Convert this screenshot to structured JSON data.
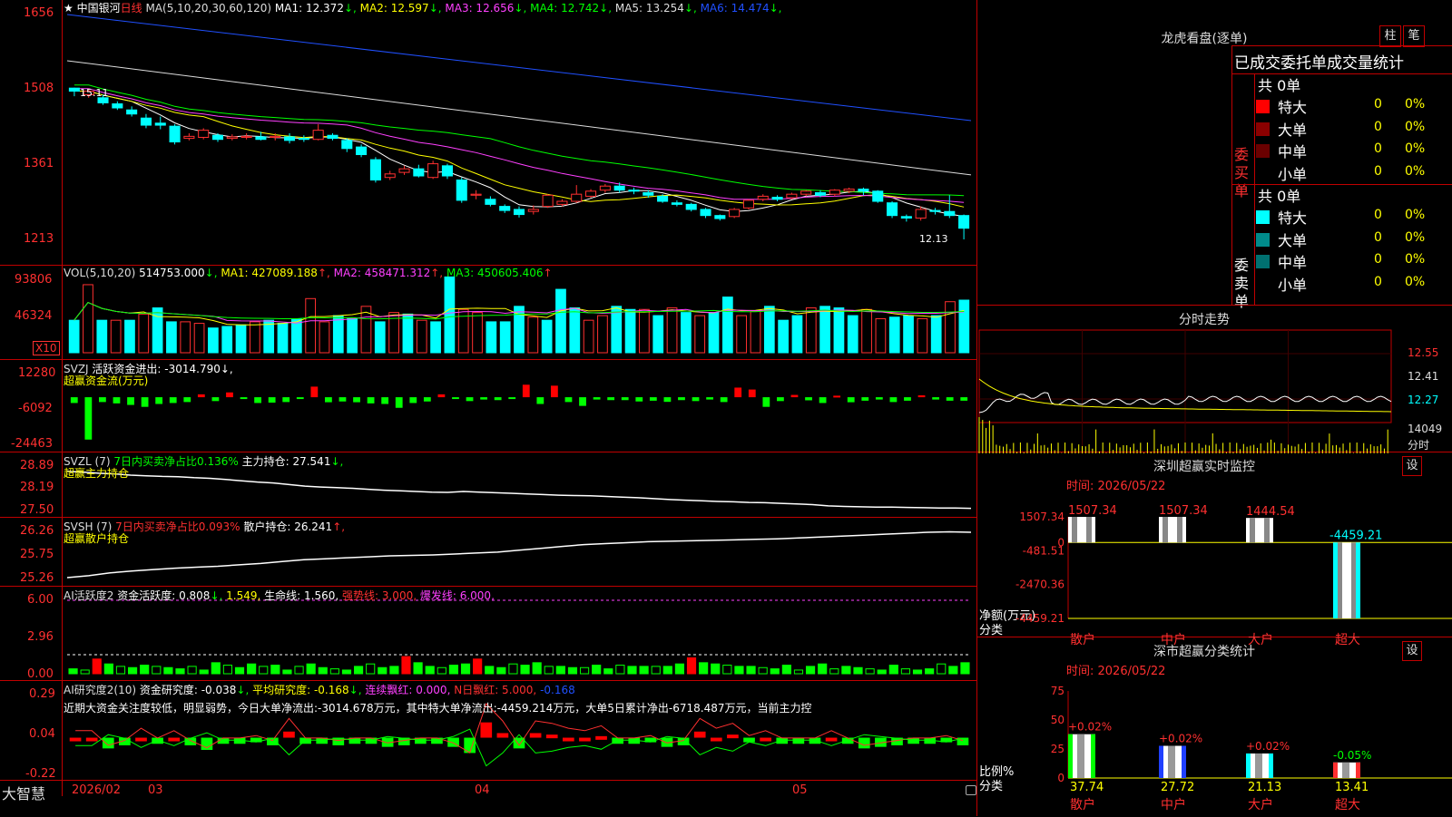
{
  "header": {
    "star": "★",
    "stock_name": "中国银河",
    "period": "日线",
    "ma_title": "MA(5,10,20,30,60,120)",
    "ma": [
      {
        "label": "MA1: 12.372",
        "arrow": "↓",
        "color": "#ffffff"
      },
      {
        "label": "MA2: 12.597",
        "arrow": "↓",
        "color": "#ffff00"
      },
      {
        "label": "MA3: 12.656",
        "arrow": "↓",
        "color": "#ff40ff"
      },
      {
        "label": "MA4: 12.742",
        "arrow": "↓",
        "color": "#00ff00"
      },
      {
        "label": "MA5: 13.254",
        "arrow": "↓",
        "color": "#dddddd"
      },
      {
        "label": "MA6: 14.474",
        "arrow": "↓",
        "color": "#2050ff"
      }
    ]
  },
  "price_panel": {
    "yticks": [
      "1656",
      "1508",
      "1361",
      "1213"
    ],
    "high_label": "15.11",
    "low_label": "12.13"
  },
  "vol_panel": {
    "title": "VOL(5,10,20)",
    "value": "514753.000",
    "ma1": "MA1: 427089.188",
    "ma2": "MA2: 458471.312",
    "ma3": "MA3: 450605.406",
    "yticks": [
      "93806",
      "46324"
    ],
    "unit": "X10"
  },
  "svzj_panel": {
    "title": "SVZJ",
    "text1": "活跃资金进出: -3014.790",
    "text2": "超赢资金流(万元)",
    "yticks": [
      "12280",
      "-6092",
      "-24463"
    ]
  },
  "svzl_panel": {
    "title": "SVZL (7)",
    "text1": "7日内买卖净占比0.136%",
    "text2": "主力持仓: 27.541",
    "text3": "超赢主力持仓",
    "yticks": [
      "28.89",
      "28.19",
      "27.50"
    ]
  },
  "svsh_panel": {
    "title": "SVSH (7)",
    "text1": "7日内买卖净占比0.093%",
    "text2": "散户持仓: 26.241",
    "text3": "超赢散户持仓",
    "yticks": [
      "26.26",
      "25.75",
      "25.26"
    ]
  },
  "ai_active_panel": {
    "title": "AI活跃度2",
    "text1": "资金活跃度: 0.808",
    "text2": "1.549,",
    "text3": "生命线: 1.560,",
    "text4": "强势线: 3.000,",
    "text5": "爆发线: 6.000,",
    "yticks": [
      "6.00",
      "2.96",
      "0.00"
    ]
  },
  "ai_research_panel": {
    "title": "AI研究度2(10)",
    "text1": "资金研究度: -0.038",
    "text2": "平均研究度: -0.168",
    "text3": "连续飘红: 0.000,",
    "text4": "N日飘红: 5.000,",
    "text5": "-0.168",
    "comment": "近期大资金关注度较低，明显弱势，今日大单净流出:-3014.678万元，其中特大单净流出:-4459.214万元，大单5日累计净出-6718.487万元，当前主力控",
    "yticks": [
      "0.29",
      "0.04",
      "-0.22"
    ]
  },
  "xaxis": {
    "labels": [
      "2026/02",
      "03",
      "04",
      "05"
    ],
    "brand": "大智慧"
  },
  "right_panel": {
    "longhu_title": "龙虎看盘(逐单)",
    "tab1": "柱",
    "tab2": "笔",
    "stats_title": "已成交委托单成交量统计",
    "buy_label": "委买单",
    "sell_label": "委卖单",
    "buy_total": "共 0单",
    "sell_total": "共 0单",
    "buy_rows": [
      {
        "name": "特大",
        "count": "0",
        "pct": "0%",
        "color": "#ff0000"
      },
      {
        "name": "大单",
        "count": "0",
        "pct": "0%",
        "color": "#8b0000"
      },
      {
        "name": "中单",
        "count": "0",
        "pct": "0%",
        "color": "#6a0000"
      },
      {
        "name": "小单",
        "count": "0",
        "pct": "0%",
        "color": "#000000"
      }
    ],
    "sell_rows": [
      {
        "name": "特大",
        "count": "0",
        "pct": "0%",
        "color": "#00ffff"
      },
      {
        "name": "大单",
        "count": "0",
        "pct": "0%",
        "color": "#008b8b"
      },
      {
        "name": "中单",
        "count": "0",
        "pct": "0%",
        "color": "#007070"
      },
      {
        "name": "小单",
        "count": "0",
        "pct": "0%",
        "color": "#000000"
      }
    ],
    "fenshi_title": "分时走势",
    "fenshi_prices": [
      "12.55",
      "12.41",
      "12.27"
    ],
    "fenshi_vol": "14049",
    "fenshi_unit": "分时",
    "sz_monitor_title": "深圳超赢实时监控",
    "sz_monitor_btn": "设",
    "sz_monitor_time": "时间: 2026/05/22",
    "sz_monitor_yticks": [
      "1507.34",
      "0",
      "-481.51",
      "-2470.36",
      "-4459.21"
    ],
    "sz_monitor_ylabel": "净额(万元)",
    "sz_monitor_xlabel": "分类",
    "sz_class_title": "深市超赢分类统计",
    "sz_class_btn": "设",
    "sz_class_time": "时间: 2026/05/22",
    "sz_class_yticks": [
      "75",
      "50",
      "25",
      "0"
    ],
    "sz_class_ylabel": "比例%",
    "sz_class_xlabel": "分类"
  },
  "chart_data": [
    {
      "type": "candlestick",
      "title": "中国银河 日线",
      "xlabels": [
        "2026/02",
        "03",
        "04",
        "05"
      ],
      "ylim": [
        1213,
        1656
      ],
      "candles": [
        [
          15.11,
          15.05,
          15.12,
          14.95
        ],
        [
          14.98,
          15.05,
          15.1,
          14.92
        ],
        [
          14.92,
          14.82,
          14.98,
          14.78
        ],
        [
          14.8,
          14.72,
          14.85,
          14.68
        ],
        [
          14.68,
          14.6,
          14.75,
          14.55
        ],
        [
          14.52,
          14.38,
          14.6,
          14.32
        ],
        [
          14.42,
          14.38,
          14.55,
          14.3
        ],
        [
          14.36,
          14.05,
          14.4,
          14.0
        ],
        [
          14.12,
          14.16,
          14.22,
          14.08
        ],
        [
          14.14,
          14.28,
          14.32,
          14.1
        ],
        [
          14.18,
          14.1,
          14.22,
          14.05
        ],
        [
          14.12,
          14.15,
          14.2,
          14.08
        ],
        [
          14.14,
          14.16,
          14.22,
          14.1
        ],
        [
          14.15,
          14.1,
          14.25,
          14.08
        ],
        [
          14.14,
          14.16,
          14.22,
          14.08
        ],
        [
          14.15,
          14.08,
          14.22,
          14.02
        ],
        [
          14.12,
          14.1,
          14.18,
          14.05
        ],
        [
          14.1,
          14.28,
          14.4,
          14.08
        ],
        [
          14.18,
          14.12,
          14.22,
          14.08
        ],
        [
          14.08,
          13.92,
          14.12,
          13.85
        ],
        [
          13.95,
          13.8,
          14.0,
          13.75
        ],
        [
          13.7,
          13.3,
          13.75,
          13.25
        ],
        [
          13.35,
          13.42,
          13.48,
          13.3
        ],
        [
          13.45,
          13.52,
          13.58,
          13.4
        ],
        [
          13.52,
          13.38,
          13.6,
          13.35
        ],
        [
          13.35,
          13.62,
          13.68,
          13.32
        ],
        [
          13.58,
          13.38,
          13.62,
          13.32
        ],
        [
          13.3,
          12.9,
          13.35,
          12.85
        ],
        [
          13.0,
          13.02,
          13.1,
          12.92
        ],
        [
          12.92,
          12.82,
          12.98,
          12.78
        ],
        [
          12.78,
          12.7,
          12.82,
          12.65
        ],
        [
          12.72,
          12.62,
          12.78,
          12.56
        ],
        [
          12.68,
          12.72,
          12.8,
          12.62
        ],
        [
          12.78,
          13.0,
          13.02,
          12.75
        ],
        [
          12.82,
          12.88,
          12.92,
          12.78
        ],
        [
          12.88,
          13.02,
          13.2,
          12.85
        ],
        [
          12.98,
          13.08,
          13.12,
          12.95
        ],
        [
          13.1,
          13.18,
          13.22,
          13.05
        ],
        [
          13.18,
          13.1,
          13.25,
          13.05
        ],
        [
          13.1,
          13.08,
          13.15,
          13.02
        ],
        [
          13.05,
          13.0,
          13.1,
          12.95
        ],
        [
          12.98,
          12.88,
          13.02,
          12.85
        ],
        [
          12.85,
          12.82,
          12.9,
          12.78
        ],
        [
          12.82,
          12.72,
          12.85,
          12.68
        ],
        [
          12.72,
          12.6,
          12.75,
          12.55
        ],
        [
          12.6,
          12.54,
          12.62,
          12.5
        ],
        [
          12.58,
          12.72,
          12.75,
          12.55
        ],
        [
          12.75,
          12.9,
          12.92,
          12.72
        ],
        [
          12.92,
          12.98,
          13.02,
          12.88
        ],
        [
          12.96,
          12.92,
          13.0,
          12.88
        ],
        [
          12.95,
          13.02,
          13.05,
          12.92
        ],
        [
          13.02,
          13.08,
          13.1,
          12.98
        ],
        [
          13.05,
          13.0,
          13.1,
          12.96
        ],
        [
          13.02,
          13.1,
          13.12,
          12.98
        ],
        [
          13.08,
          13.12,
          13.15,
          13.04
        ],
        [
          13.12,
          13.08,
          13.15,
          13.0
        ],
        [
          13.08,
          12.88,
          13.1,
          12.85
        ],
        [
          12.85,
          12.6,
          12.88,
          12.55
        ],
        [
          12.58,
          12.55,
          12.62,
          12.48
        ],
        [
          12.55,
          12.72,
          12.78,
          12.5
        ],
        [
          12.7,
          12.68,
          12.75,
          12.62
        ],
        [
          12.68,
          12.6,
          13.0,
          12.55
        ],
        [
          12.6,
          12.35,
          12.62,
          12.13
        ]
      ]
    },
    {
      "type": "bar",
      "title": "VOL(5,10,20)",
      "ylim": [
        0,
        93806
      ],
      "values": [
        42000,
        88000,
        42000,
        42000,
        42000,
        50000,
        58000,
        40000,
        40000,
        38000,
        32000,
        34000,
        36000,
        40000,
        42000,
        38000,
        44000,
        70000,
        40000,
        48000,
        44000,
        60000,
        40000,
        52000,
        50000,
        42000,
        40000,
        98000,
        56000,
        52000,
        40000,
        40000,
        60000,
        46000,
        42000,
        82000,
        58000,
        42000,
        48000,
        60000,
        56000,
        56000,
        48000,
        58000,
        52000,
        48000,
        52000,
        72000,
        48000,
        54000,
        60000,
        42000,
        48000,
        58000,
        60000,
        58000,
        48000,
        56000,
        44000,
        46000,
        48000,
        44000,
        48000,
        66000,
        68000
      ]
    },
    {
      "type": "bar",
      "title": "SVZJ 超赢资金流(万元)",
      "ylim": [
        -24463,
        12280
      ],
      "values": [
        -3000,
        -22000,
        -2500,
        -3200,
        -4000,
        -5000,
        -3500,
        -3000,
        -2500,
        1500,
        -2000,
        2500,
        -800,
        -3000,
        -2800,
        -2500,
        -500,
        5500,
        -2600,
        -2200,
        -2600,
        -3200,
        -3500,
        -5500,
        -3000,
        -2200,
        1500,
        -500,
        -2000,
        -1200,
        -1500,
        -600,
        6500,
        -3500,
        6000,
        -2500,
        -4500,
        -1200,
        -1500,
        -1500,
        -2200,
        -1800,
        -2400,
        -1500,
        -2000,
        -1200,
        -2500,
        5000,
        4000,
        -5000,
        -2000,
        1200,
        -1600,
        -3000,
        800,
        -2600,
        -1800,
        -1200,
        -2500,
        -1800,
        1000,
        -1200,
        -1800,
        -1800
      ]
    },
    {
      "type": "line",
      "title": "SVZL 超赢主力持仓",
      "ylim": [
        27.5,
        28.89
      ],
      "values": [
        28.72,
        28.7,
        28.66,
        28.64,
        28.6,
        28.58,
        28.56,
        28.55,
        28.52,
        28.5,
        28.46,
        28.42,
        28.38,
        28.35,
        28.3,
        28.25,
        28.22,
        28.2,
        28.18,
        28.15,
        28.12,
        28.1,
        28.08,
        28.06,
        28.05,
        28.08,
        28.06,
        28.04,
        28.02,
        28.0,
        27.98,
        27.96,
        27.95,
        27.94,
        27.92,
        27.9,
        27.88,
        27.85,
        27.82,
        27.8,
        27.78,
        27.76,
        27.75,
        27.73,
        27.72,
        27.7,
        27.68,
        27.66,
        27.62,
        27.6,
        27.59,
        27.58,
        27.58,
        27.57,
        27.56,
        27.55,
        27.55,
        27.54
      ]
    },
    {
      "type": "line",
      "title": "SVSH 超赢散户持仓",
      "ylim": [
        25.26,
        26.26
      ],
      "values": [
        25.28,
        25.32,
        25.38,
        25.42,
        25.45,
        25.48,
        25.5,
        25.52,
        25.55,
        25.58,
        25.62,
        25.66,
        25.68,
        25.7,
        25.72,
        25.74,
        25.75,
        25.76,
        25.78,
        25.8,
        25.82,
        25.86,
        25.9,
        25.94,
        25.98,
        26.0,
        26.02,
        26.04,
        26.05,
        26.06,
        26.07,
        26.08,
        26.09,
        26.1,
        26.12,
        26.14,
        26.16,
        26.18,
        26.2,
        26.22,
        26.24,
        26.25,
        26.24
      ]
    },
    {
      "type": "bar",
      "title": "AI活跃度2",
      "ylim": [
        0,
        6.0
      ],
      "values": [
        0.4,
        0.3,
        1.2,
        0.8,
        0.6,
        0.5,
        0.7,
        0.6,
        0.5,
        0.4,
        0.6,
        0.3,
        0.9,
        0.7,
        0.5,
        0.8,
        0.6,
        0.7,
        0.3,
        0.6,
        0.8,
        0.5,
        0.4,
        0.3,
        0.6,
        0.8,
        0.5,
        0.6,
        1.4,
        0.9,
        0.6,
        0.5,
        0.7,
        0.8,
        1.2,
        0.6,
        0.5,
        0.8,
        0.7,
        0.9,
        0.6,
        0.6,
        0.5,
        0.5,
        0.7,
        0.4,
        0.7,
        0.6,
        0.6,
        0.6,
        0.6,
        0.8,
        1.3,
        0.9,
        0.8,
        0.7,
        0.6,
        0.6,
        0.5,
        0.4,
        0.7,
        0.3,
        0.6,
        0.8,
        0.4,
        0.6,
        0.5,
        0.4,
        0.3,
        0.7,
        0.4,
        0.3,
        0.4,
        0.8,
        0.6,
        0.9
      ]
    },
    {
      "type": "bar",
      "title": "AI研究度2(10)",
      "ylim": [
        -0.22,
        0.29
      ],
      "values": [
        0.01,
        0.01,
        -0.05,
        -0.03,
        0.02,
        -0.02,
        0.01,
        -0.03,
        -0.06,
        -0.02,
        -0.02,
        -0.01,
        -0.03,
        0.06,
        -0.02,
        -0.02,
        -0.03,
        -0.02,
        -0.02,
        -0.04,
        -0.03,
        -0.02,
        -0.02,
        -0.04,
        -0.08,
        0.12,
        0.05,
        -0.05,
        0.05,
        0.04,
        0.02,
        0.01,
        0.03,
        -0.02,
        -0.02,
        -0.01,
        -0.04,
        -0.03,
        0.06,
        0.02,
        0.04,
        -0.01,
        0.01,
        -0.02,
        -0.02,
        -0.02,
        0.01,
        -0.02,
        -0.05,
        -0.04,
        -0.03,
        -0.02,
        -0.02,
        -0.01,
        -0.03
      ]
    },
    {
      "type": "bar",
      "title": "深圳超赢实时监控",
      "ylim": [
        -4459.21,
        1507.34
      ],
      "categories": [
        "散户",
        "中户",
        "大户",
        "超大"
      ],
      "values": [
        1507.34,
        1507.34,
        1444.54,
        -4459.21
      ],
      "value_labels": [
        "1507.34",
        "1507.34",
        "1444.54",
        "-4459.21"
      ]
    },
    {
      "type": "bar",
      "title": "深市超赢分类统计",
      "ylim": [
        0,
        75
      ],
      "categories": [
        "散户",
        "中户",
        "大户",
        "超大"
      ],
      "values": [
        37.74,
        27.72,
        21.13,
        13.41
      ],
      "changes": [
        "+0.02%",
        "+0.02%",
        "+0.02%",
        "-0.05%"
      ]
    }
  ]
}
